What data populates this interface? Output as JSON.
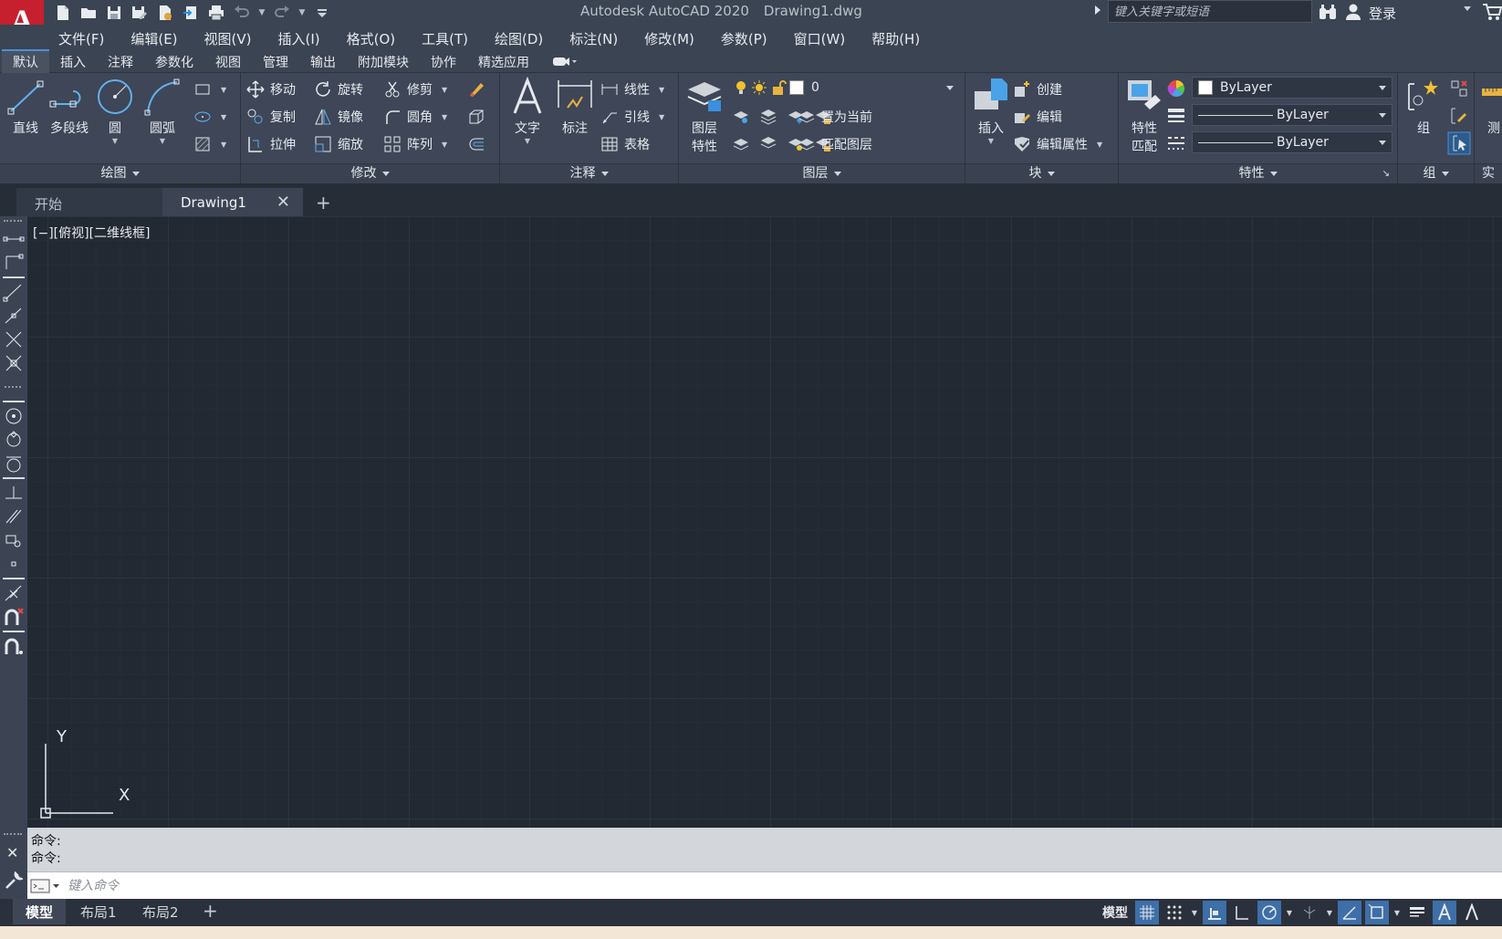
{
  "app": {
    "logo_letter": "A",
    "title": "Autodesk AutoCAD 2020",
    "filename": "Drawing1.dwg",
    "search_placeholder": "键入关键字或短语",
    "login_label": "登录"
  },
  "menu": [
    "文件(F)",
    "编辑(E)",
    "视图(V)",
    "插入(I)",
    "格式(O)",
    "工具(T)",
    "绘图(D)",
    "标注(N)",
    "修改(M)",
    "参数(P)",
    "窗口(W)",
    "帮助(H)"
  ],
  "ribbon_tabs": [
    "默认",
    "插入",
    "注释",
    "参数化",
    "视图",
    "管理",
    "输出",
    "附加模块",
    "协作",
    "精选应用"
  ],
  "panels": {
    "draw": {
      "title": "绘图",
      "line": "直线",
      "polyline": "多段线",
      "circle": "圆",
      "arc": "圆弧"
    },
    "modify": {
      "title": "修改",
      "move": "移动",
      "rotate": "旋转",
      "trim": "修剪",
      "copy": "复制",
      "mirror": "镜像",
      "fillet": "圆角",
      "stretch": "拉伸",
      "scale": "缩放",
      "array": "阵列"
    },
    "annotation": {
      "title": "注释",
      "text": "文字",
      "dimension": "标注",
      "linear": "线性",
      "leader": "引线",
      "table": "表格"
    },
    "layers": {
      "title": "图层",
      "layer_props_1": "图层",
      "layer_props_2": "特性",
      "current_layer": "0",
      "set_current": "置为当前",
      "match_layer": "匹配图层"
    },
    "block": {
      "title": "块",
      "insert": "插入",
      "create": "创建",
      "edit": "编辑",
      "edit_attributes": "编辑属性"
    },
    "properties": {
      "title": "特性",
      "match_1": "特性",
      "match_2": "匹配",
      "color": "ByLayer",
      "linetype": "ByLayer",
      "lineweight": "ByLayer"
    },
    "groups": {
      "title": "组",
      "group": "组"
    },
    "utilities": {
      "title": "实用",
      "measure": "测"
    }
  },
  "doc_tabs": {
    "start": "开始",
    "active": "Drawing1"
  },
  "viewport": {
    "label": "[−][俯视][二维线框]",
    "ucs_x": "X",
    "ucs_y": "Y"
  },
  "command": {
    "history": [
      "命令:",
      "命令:"
    ],
    "placeholder": "键入命令"
  },
  "layout_tabs": [
    "模型",
    "布局1",
    "布局2"
  ],
  "status": {
    "model": "模型"
  },
  "colors": {
    "accent": "#4b8fd6",
    "logo_red": "#c6202e",
    "canvas": "#222932",
    "ribbon": "#3e4657",
    "status_on": "#3e6fa8"
  }
}
